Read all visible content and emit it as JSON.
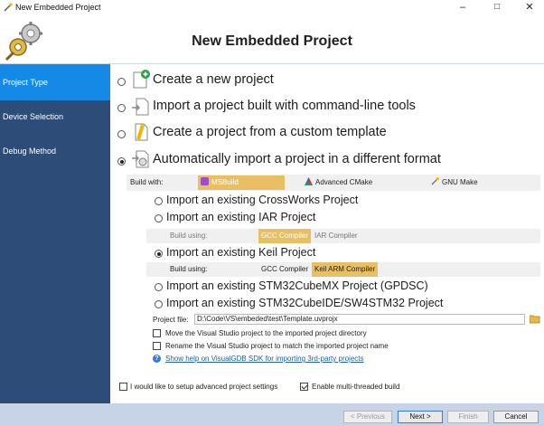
{
  "window": {
    "title": "New Embedded Project",
    "minimize": "–",
    "maximize": "□",
    "close": "✕"
  },
  "header": {
    "title": "New Embedded Project",
    "logo_icon": "gears-wizard-icon"
  },
  "sidebar": {
    "items": [
      {
        "label": "Project Type",
        "active": true
      },
      {
        "label": "Device Selection",
        "active": false
      },
      {
        "label": "Debug Method",
        "active": false
      }
    ]
  },
  "options": {
    "create_new": "Create a new project",
    "import_cmdline": "Import a project built with command-line tools",
    "custom_template": "Create a project from a custom template",
    "auto_import": "Automatically import a project in a different format"
  },
  "build_with": {
    "label": "Build with:",
    "choices": [
      {
        "label": "MSBuild",
        "selected": true
      },
      {
        "label": "Advanced CMake",
        "selected": false
      },
      {
        "label": "GNU Make",
        "selected": false
      }
    ]
  },
  "import_types": {
    "crossworks": "Import an existing CrossWorks Project",
    "iar": "Import an existing IAR Project",
    "keil": "Import an existing Keil Project",
    "stm32cubemx": "Import an existing STM32CubeMX Project (GPDSC)",
    "stm32cubeide": "Import an existing STM32CubeIDE/SW4STM32 Project"
  },
  "iar_build_using": {
    "label": "Build using:",
    "gcc": "GCC Compiler",
    "other": "IAR Compiler"
  },
  "keil_build_using": {
    "label": "Build using:",
    "gcc": "GCC Compiler",
    "other": "Keil ARM Compiler"
  },
  "project_file": {
    "label": "Project file:",
    "value": "D:\\Code\\VS\\embeded\\test\\Template.uvprojx"
  },
  "checks": {
    "move_project": "Move the Visual Studio project to the imported project directory",
    "rename_project": "Rename the Visual Studio project to match the imported project name",
    "help_link": "Show help on VisualGDB SDK for importing 3rd-party projects",
    "advanced_settings": "I would like to setup advanced project settings",
    "multithreaded": "Enable multi-threaded build"
  },
  "footer": {
    "previous": "< Previous",
    "next": "Next >",
    "finish": "Finish",
    "cancel": "Cancel"
  },
  "colors": {
    "sidebar": "#2d4d78",
    "sidebar_active": "#1589e6",
    "selected_chip": "#e9bf64",
    "footer": "#c7d3e6"
  }
}
